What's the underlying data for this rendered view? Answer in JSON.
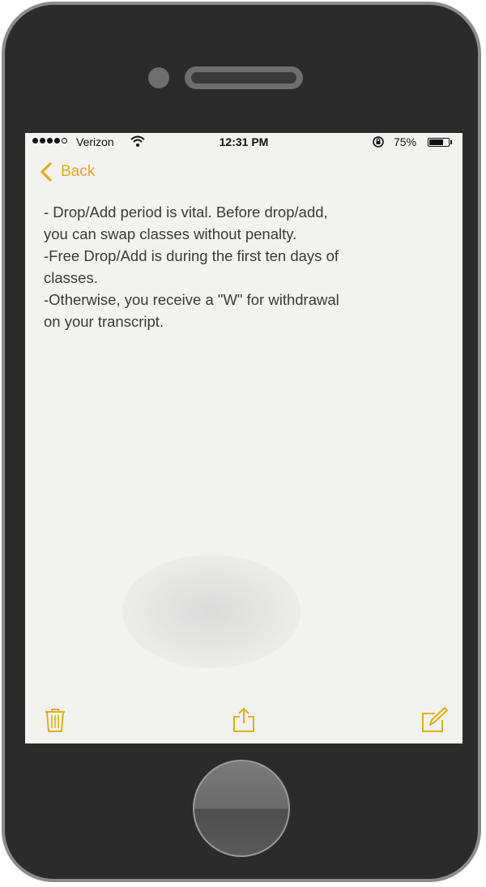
{
  "status_bar": {
    "carrier": "Verizon",
    "wifi_icon": "wifi-icon",
    "time": "12:31 PM",
    "rotation_lock_icon": "rotation-lock-icon",
    "battery_text": "75%",
    "battery_level": 0.75
  },
  "nav": {
    "back_label": "Back",
    "back_icon": "chevron-left-icon"
  },
  "note": {
    "text": "- Drop/Add period is vital. Before drop/add,\nyou can swap classes without penalty.\n-Free Drop/Add is during the first ten days of\nclasses.\n-Otherwise, you receive a \"W\" for withdrawal\non your transcript."
  },
  "toolbar": {
    "delete_icon": "trash-icon",
    "share_icon": "share-icon",
    "compose_icon": "compose-icon"
  },
  "colors": {
    "accent": "#e0ae1b",
    "phone_body": "#2b2b2b",
    "screen_bg": "#f2f2f1"
  }
}
